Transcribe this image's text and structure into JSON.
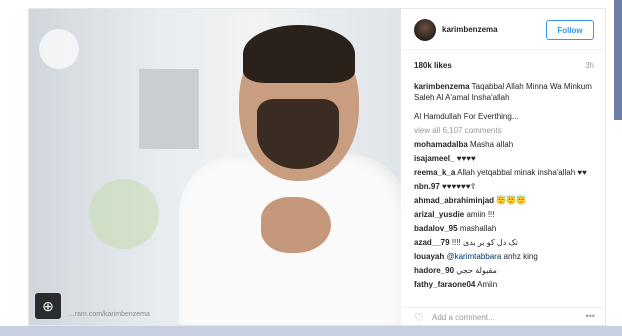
{
  "post": {
    "username": "karimbenzema",
    "follow_label": "Follow",
    "likes": "180k likes",
    "time": "3h",
    "caption_user": "karimbenzema",
    "caption_text": "Taqabbal Allah Minna Wa Minkum Saleh Al A'amal Insha'allah",
    "caption_line2": "Al Hamdullah For Everthing...",
    "view_all": "view all 6,107 comments",
    "comments": [
      {
        "user": "mohamadalba",
        "text": "Masha allah"
      },
      {
        "user": "isajameel_",
        "text": "♥♥♥♥"
      },
      {
        "user": "reema_k_a",
        "text": "Allah yetqabbal minak insha'allah ♥♥"
      },
      {
        "user": "nbn.97",
        "text": "♥♥♥♥♥♥☦"
      },
      {
        "user": "ahmad_abrahiminjad",
        "text": "😇😇😇"
      },
      {
        "user": "arizal_yusdie",
        "text": "amiin !!!"
      },
      {
        "user": "badalov_95",
        "text": "mashallah"
      },
      {
        "user": "azad__79",
        "text": "!!!! تک دل کو بر بدی"
      },
      {
        "user": "louayah",
        "mention": "@karimtabbara",
        "text": "anhz king"
      },
      {
        "user": "hadore_90",
        "text": "مقبولة حجي"
      },
      {
        "user": "fathy_faraone04",
        "text": "Amiin"
      }
    ],
    "add_comment": "Add a comment..."
  },
  "overlay": {
    "watermark": "...ram.com/karimbenzema"
  },
  "icons": {
    "zoom": "zoom-in-icon",
    "heart": "heart-icon",
    "more": "more-options-icon"
  },
  "colors": {
    "follow_blue": "#3897f0",
    "mention": "#003569"
  }
}
